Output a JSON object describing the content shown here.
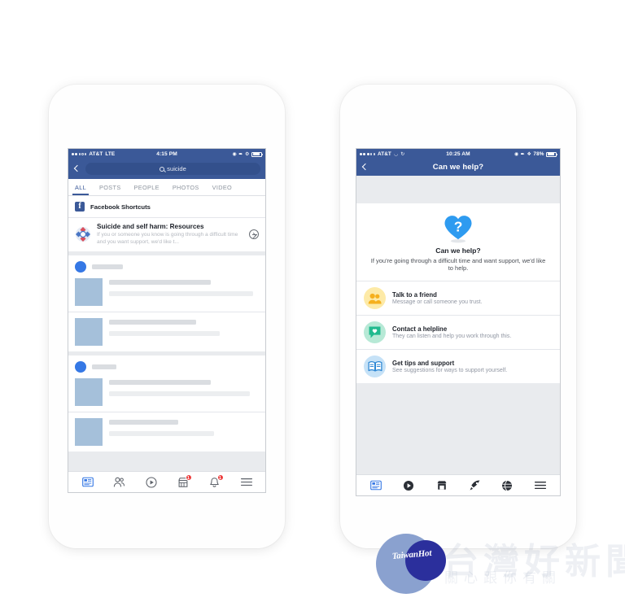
{
  "left_phone": {
    "status_bar": {
      "carrier": "AT&T",
      "network": "LTE",
      "time": "4:15 PM",
      "battery_level": "",
      "signal_dots_filled": 2,
      "signal_dots_hollow": 3
    },
    "nav": {
      "back_icon": "chevron-left-icon",
      "search_icon": "search-icon",
      "search_value": "suicide",
      "search_placeholder": "Search"
    },
    "tabs": [
      {
        "label": "ALL",
        "active": true
      },
      {
        "label": "POSTS",
        "active": false
      },
      {
        "label": "PEOPLE",
        "active": false
      },
      {
        "label": "PHOTOS",
        "active": false
      },
      {
        "label": "VIDEO",
        "active": false
      }
    ],
    "shortcut_row": {
      "icon": "facebook-icon",
      "glyph": "f",
      "label": "Facebook Shortcuts"
    },
    "resource_row": {
      "icon": "lifebuoy-icon",
      "title": "Suicide and self harm: Resources",
      "subtitle": "If you or someone you know is going through a difficult time and you want support, we'd like t...",
      "arrow_icon": "arrow-right-circle-icon"
    },
    "feed_skeleton": {
      "note": "placeholder content blocks",
      "cards": [
        {
          "has_avatar": true,
          "items": 2
        },
        {
          "has_avatar": true,
          "items": 2
        }
      ]
    },
    "tabbar": [
      {
        "name": "news-feed-icon",
        "badge": ""
      },
      {
        "name": "friends-icon",
        "badge": ""
      },
      {
        "name": "video-icon",
        "badge": ""
      },
      {
        "name": "marketplace-icon",
        "badge": "1"
      },
      {
        "name": "notifications-bell-icon",
        "badge": "1"
      },
      {
        "name": "menu-hamburger-icon",
        "badge": ""
      }
    ]
  },
  "right_phone": {
    "status_bar": {
      "carrier": "AT&T",
      "wifi_icon": "wifi-icon",
      "time": "10:25 AM",
      "battery_text": "78%",
      "signal_dots_filled": 3,
      "signal_dots_hollow": 2
    },
    "nav": {
      "back_icon": "chevron-left-icon",
      "title": "Can we help?"
    },
    "hero": {
      "icon": "heart-question-icon",
      "title": "Can we help?",
      "subtitle": "If you're going through a difficult time and want support, we'd like to help."
    },
    "options": [
      {
        "icon": "friends-icon",
        "icon_bg": "#fdeaa7",
        "icon_fg": "#f5b01e",
        "title": "Talk to a friend",
        "subtitle": "Message or call someone you trust."
      },
      {
        "icon": "chat-heart-icon",
        "icon_bg": "#b7e9d6",
        "icon_fg": "#21ba8e",
        "title": "Contact a helpline",
        "subtitle": "They can listen and help you work through this."
      },
      {
        "icon": "open-book-icon",
        "icon_bg": "#c6e2f7",
        "icon_fg": "#2e88d4",
        "title": "Get tips and support",
        "subtitle": "See suggestions for ways to support yourself."
      }
    ],
    "tabbar": [
      {
        "name": "news-feed-icon"
      },
      {
        "name": "video-icon"
      },
      {
        "name": "marketplace-icon"
      },
      {
        "name": "rocket-icon"
      },
      {
        "name": "globe-icon"
      },
      {
        "name": "menu-hamburger-icon"
      }
    ]
  },
  "watermark": {
    "logo_text": "TaiwanHot",
    "headline": "台灣好新聞",
    "tagline": "關心跟你有關"
  },
  "colors": {
    "facebook_blue": "#3b5998",
    "search_pill": "#33508c",
    "screen_gray": "#e9ebee",
    "skeleton_gray": "#dadde1",
    "thumb_blue": "#a5c0da",
    "avatar_blue": "#3578e5",
    "badge_red": "#ec3b3b",
    "heart_blue": "#2e9bf0"
  }
}
